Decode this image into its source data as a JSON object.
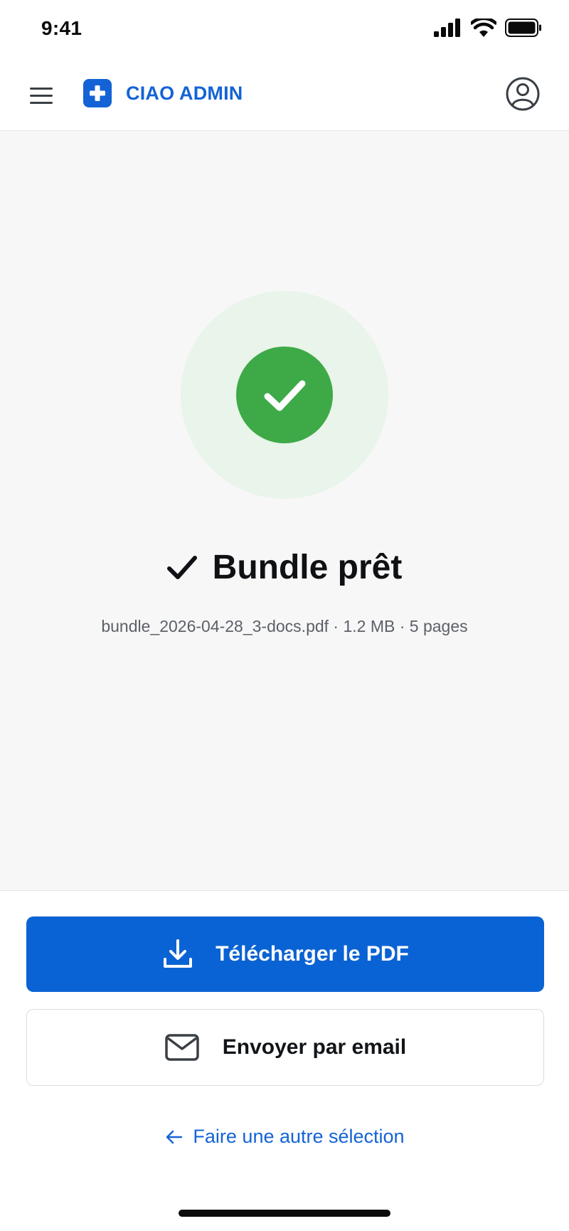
{
  "status_bar": {
    "time": "9:41"
  },
  "header": {
    "brand_name": "CIAO ADMIN"
  },
  "result": {
    "title": "Bundle prêt",
    "file_meta": "bundle_2026-04-28_3-docs.pdf · 1.2 MB · 5 pages"
  },
  "actions": {
    "download_label": "Télécharger le PDF",
    "email_label": "Envoyer par email",
    "back_label": "Faire une autre sélection"
  },
  "icons": {
    "menu": "hamburger-icon",
    "logo": "plus-cross-icon",
    "profile": "user-circle-icon",
    "success": "checkmark-icon",
    "download": "download-icon",
    "email": "envelope-icon",
    "back": "arrow-left-icon"
  },
  "colors": {
    "brand": "#1463d6",
    "primary_button": "#0a63d4",
    "success": "#3daa47",
    "success_halo": "#e9f4ea"
  }
}
